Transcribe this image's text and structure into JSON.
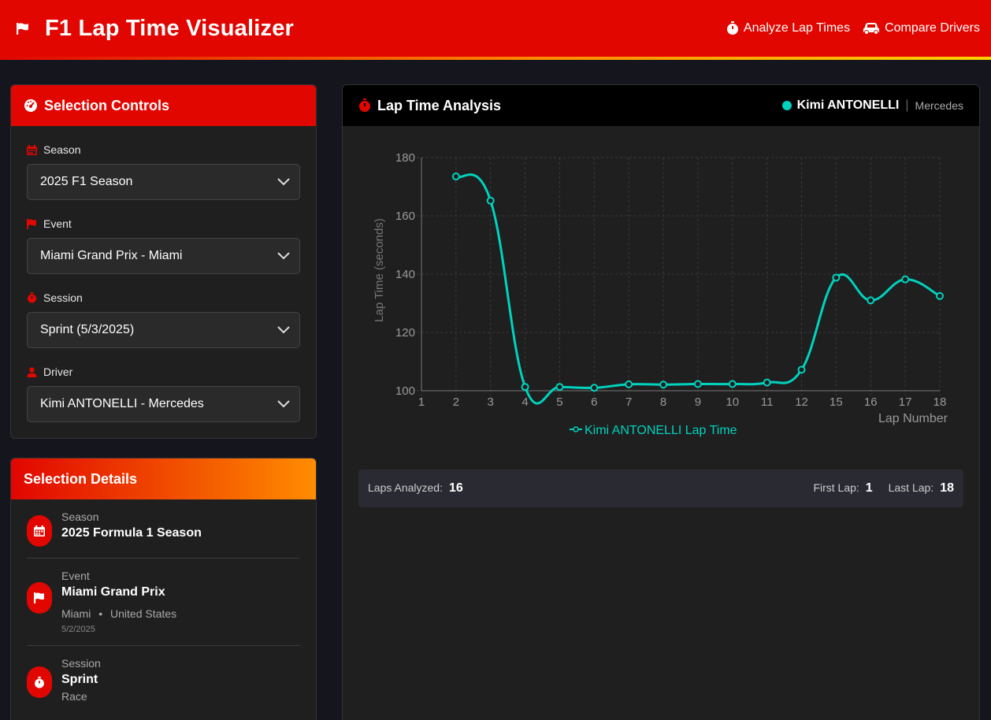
{
  "header": {
    "title": "F1 Lap Time Visualizer",
    "nav": [
      {
        "label": "Analyze Lap Times",
        "icon": "stopwatch-icon"
      },
      {
        "label": "Compare Drivers",
        "icon": "car-icon"
      }
    ]
  },
  "controls": {
    "title": "Selection Controls",
    "fields": [
      {
        "label": "Season",
        "value": "2025 F1 Season",
        "icon": "calendar-icon"
      },
      {
        "label": "Event",
        "value": "Miami Grand Prix - Miami",
        "icon": "flag-icon"
      },
      {
        "label": "Session",
        "value": "Sprint (5/3/2025)",
        "icon": "stopwatch-icon"
      },
      {
        "label": "Driver",
        "value": "Kimi ANTONELLI - Mercedes",
        "icon": "user-icon"
      }
    ]
  },
  "details": {
    "title": "Selection Details",
    "season": {
      "label": "Season",
      "value": "2025 Formula 1 Season"
    },
    "event": {
      "label": "Event",
      "value": "Miami Grand Prix",
      "city": "Miami",
      "country": "United States",
      "date": "5/2/2025"
    },
    "session": {
      "label": "Session",
      "value": "Sprint",
      "type": "Race"
    }
  },
  "chart_panel": {
    "title": "Lap Time Analysis",
    "driver": "Kimi ANTONELLI",
    "team": "Mercedes",
    "driver_color": "#00d2be"
  },
  "chart_data": {
    "type": "line",
    "x_ticks": [
      "1",
      "2",
      "3",
      "4",
      "5",
      "6",
      "7",
      "8",
      "9",
      "10",
      "11",
      "12",
      "15",
      "16",
      "17",
      "18"
    ],
    "x": [
      2,
      3,
      4,
      5,
      6,
      7,
      8,
      9,
      10,
      11,
      12,
      15,
      16,
      17,
      18
    ],
    "y": [
      173.5,
      165.2,
      101.3,
      101.3,
      101.0,
      102.2,
      102.1,
      102.3,
      102.3,
      102.8,
      107.2,
      138.8,
      131.0,
      138.2,
      132.5
    ],
    "ylim": [
      100,
      180
    ],
    "y_ticks": [
      "100",
      "120",
      "140",
      "160",
      "180"
    ],
    "xlabel": "Lap Number",
    "ylabel": "Lap Time (seconds)",
    "series_name": "Kimi ANTONELLI Lap Time",
    "grid": true,
    "legend": "bottom-center"
  },
  "stats": {
    "laps_analyzed_label": "Laps Analyzed:",
    "laps_analyzed": "16",
    "first_lap_label": "First Lap:",
    "first_lap": "1",
    "last_lap_label": "Last Lap:",
    "last_lap": "18"
  }
}
